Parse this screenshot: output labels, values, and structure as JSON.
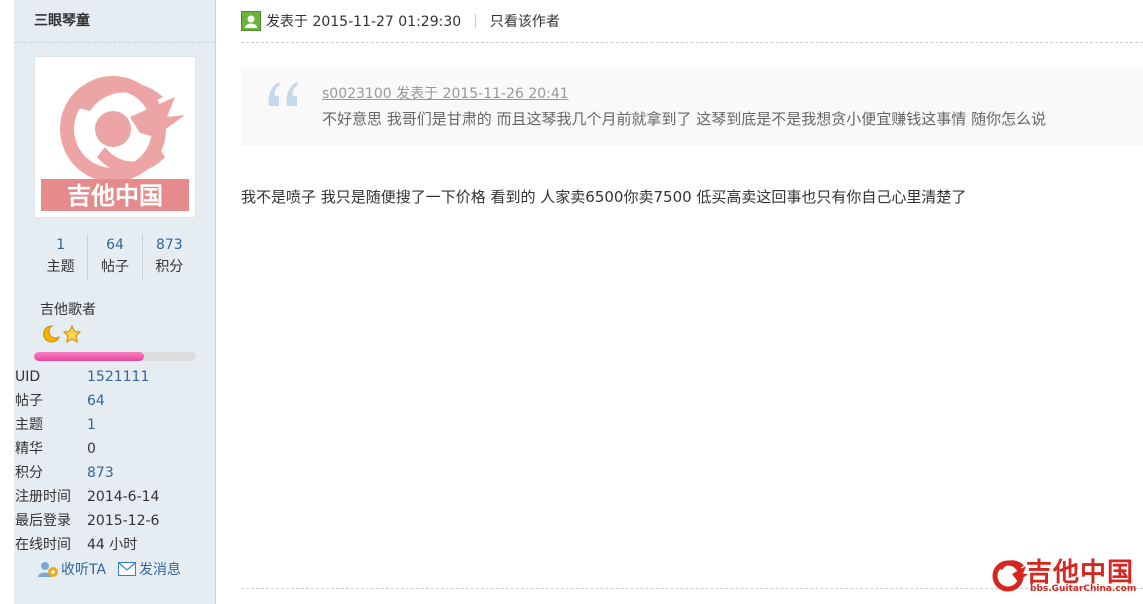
{
  "author": {
    "name": "三眼琴童",
    "avatar_text": "吉他中国",
    "stats": [
      {
        "value": "1",
        "label": "主题"
      },
      {
        "value": "64",
        "label": "帖子"
      },
      {
        "value": "873",
        "label": "积分"
      }
    ],
    "group": "吉他歌者",
    "rank_icons": [
      "moon-icon",
      "star-icon"
    ],
    "progress_fraction": 0.68,
    "progress_color": "#e8479d",
    "info": [
      {
        "key": "UID",
        "value": "1521111"
      },
      {
        "key": "帖子",
        "value": "64"
      },
      {
        "key": "主题",
        "value": "1"
      },
      {
        "key": "精华",
        "value": "0"
      },
      {
        "key": "积分",
        "value": "873"
      },
      {
        "key": "注册时间",
        "value": "2014-6-14"
      },
      {
        "key": "最后登录",
        "value": "2015-12-6"
      },
      {
        "key": "在线时间",
        "value": "44 小时"
      }
    ],
    "actions": {
      "follow_label": "收听TA",
      "message_label": "发消息"
    }
  },
  "post": {
    "posted_at": "发表于 2015-11-27 01:29:30",
    "separator": "|",
    "only_author_label": "只看该作者",
    "quote": {
      "ref": "s0023100 发表于 2015-11-26 20:41",
      "text": "不好意思 我哥们是甘肃的 而且这琴我几个月前就拿到了 这琴到底是不是我想贪小便宜赚钱这事情 随你怎么说"
    },
    "body": "我不是喷子 我只是随便搜了一下价格 看到的 人家卖6500你卖7500 低买高卖这回事也只有你自己心里清楚了"
  },
  "watermark": {
    "text": "吉他中国",
    "url": "bbs.GuitarChina.com"
  },
  "colors": {
    "sidebar_bg": "#e5edf2",
    "link": "#336699",
    "brand_red": "#d6261f"
  }
}
